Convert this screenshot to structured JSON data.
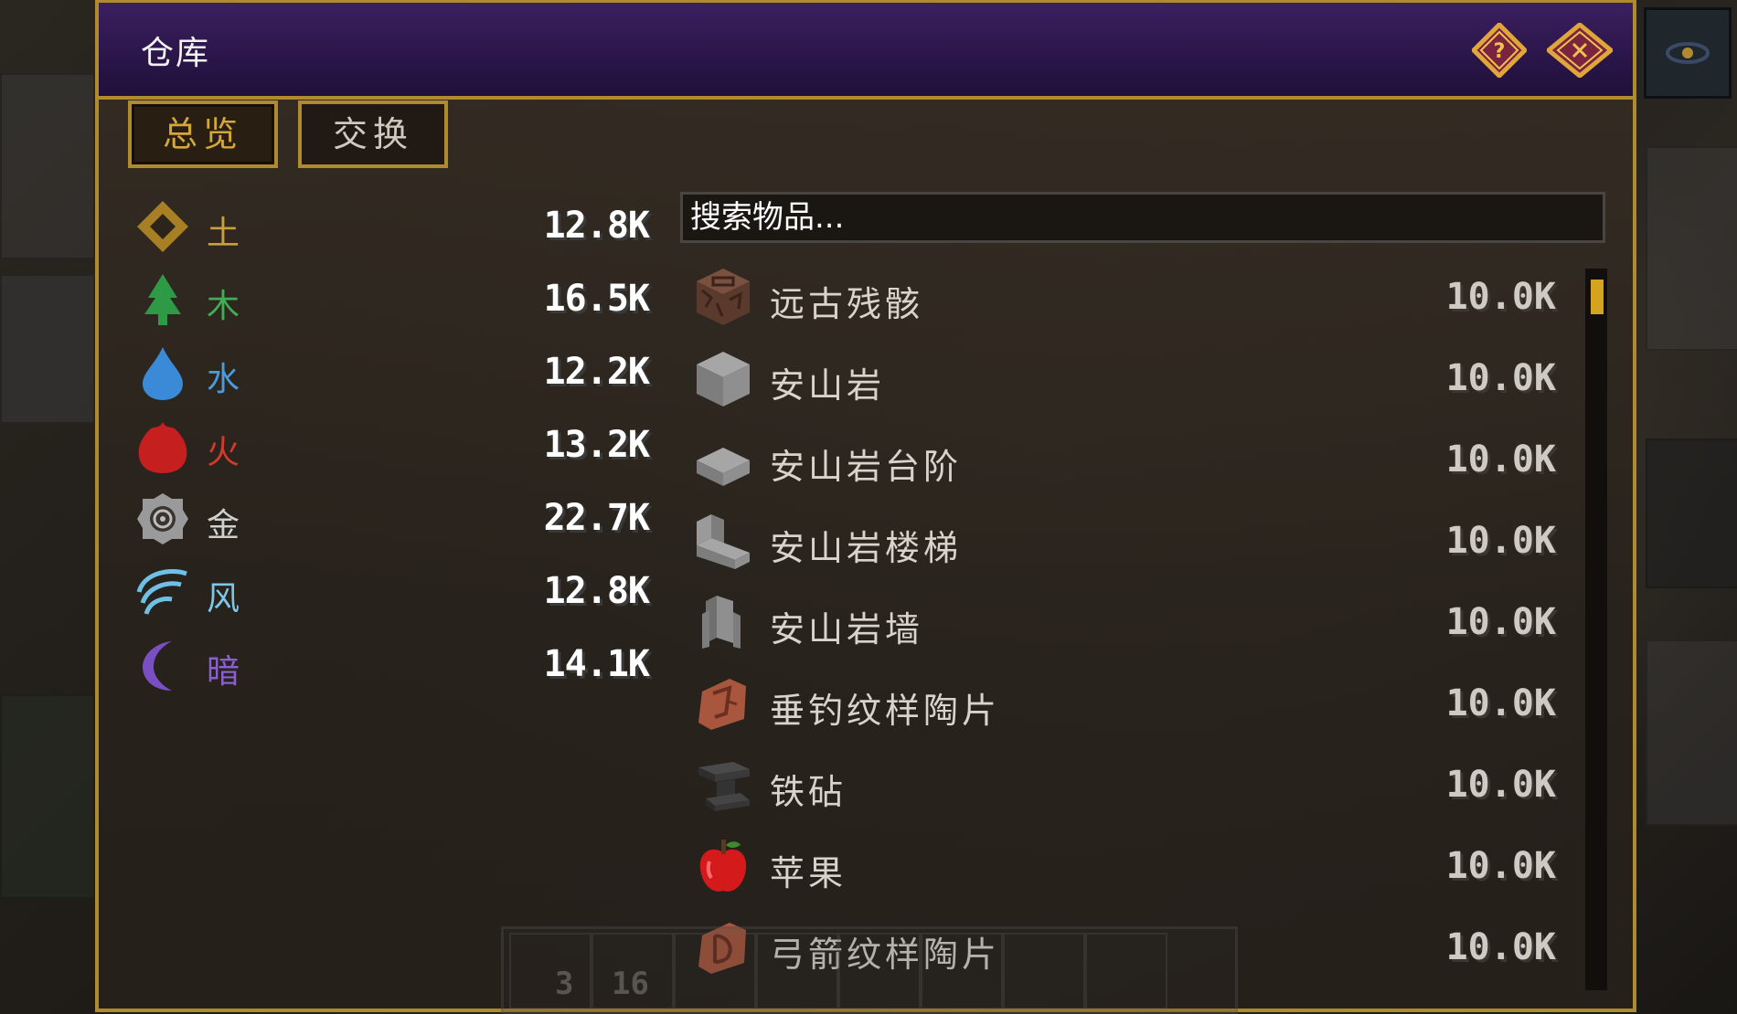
{
  "window": {
    "title": "仓库",
    "help_icon": "question-mark-diamond-icon",
    "close_icon": "close-x-diamond-icon"
  },
  "tabs": [
    {
      "label": "总览",
      "active": true
    },
    {
      "label": "交换",
      "active": false
    }
  ],
  "elements": [
    {
      "name": "土",
      "value": "12.8K",
      "color": "#c9a13a",
      "icon": "earth-diamond-icon"
    },
    {
      "name": "木",
      "value": "16.5K",
      "color": "#3fae55",
      "icon": "tree-icon"
    },
    {
      "name": "水",
      "value": "12.2K",
      "color": "#4a9be0",
      "icon": "water-drop-icon"
    },
    {
      "name": "火",
      "value": "13.2K",
      "color": "#d23a2a",
      "icon": "fire-icon"
    },
    {
      "name": "金",
      "value": "22.7K",
      "color": "#cfcfcf",
      "icon": "metal-gear-icon"
    },
    {
      "name": "风",
      "value": "12.8K",
      "color": "#7dc6e8",
      "icon": "wind-icon"
    },
    {
      "name": "暗",
      "value": "14.1K",
      "color": "#8b5fd0",
      "icon": "dark-crescent-icon"
    }
  ],
  "search": {
    "placeholder": "搜索物品..."
  },
  "items": [
    {
      "name": "远古残骸",
      "count": "10.0K",
      "icon": "ancient-debris-icon"
    },
    {
      "name": "安山岩",
      "count": "10.0K",
      "icon": "andesite-block-icon"
    },
    {
      "name": "安山岩台阶",
      "count": "10.0K",
      "icon": "andesite-slab-icon"
    },
    {
      "name": "安山岩楼梯",
      "count": "10.0K",
      "icon": "andesite-stairs-icon"
    },
    {
      "name": "安山岩墙",
      "count": "10.0K",
      "icon": "andesite-wall-icon"
    },
    {
      "name": "垂钓纹样陶片",
      "count": "10.0K",
      "icon": "pottery-sherd-icon"
    },
    {
      "name": "铁砧",
      "count": "10.0K",
      "icon": "anvil-icon"
    },
    {
      "name": "苹果",
      "count": "10.0K",
      "icon": "apple-icon"
    },
    {
      "name": "弓箭纹样陶片",
      "count": "10.0K",
      "icon": "pottery-sherd-icon"
    }
  ],
  "scrollbar": {
    "position": 0.0
  },
  "hotbar": {
    "counts": [
      "3",
      "16"
    ]
  },
  "colors": {
    "gold_border": "#b08a2e",
    "title_bar": "#2a1548",
    "scroll_thumb": "#d4a320"
  }
}
